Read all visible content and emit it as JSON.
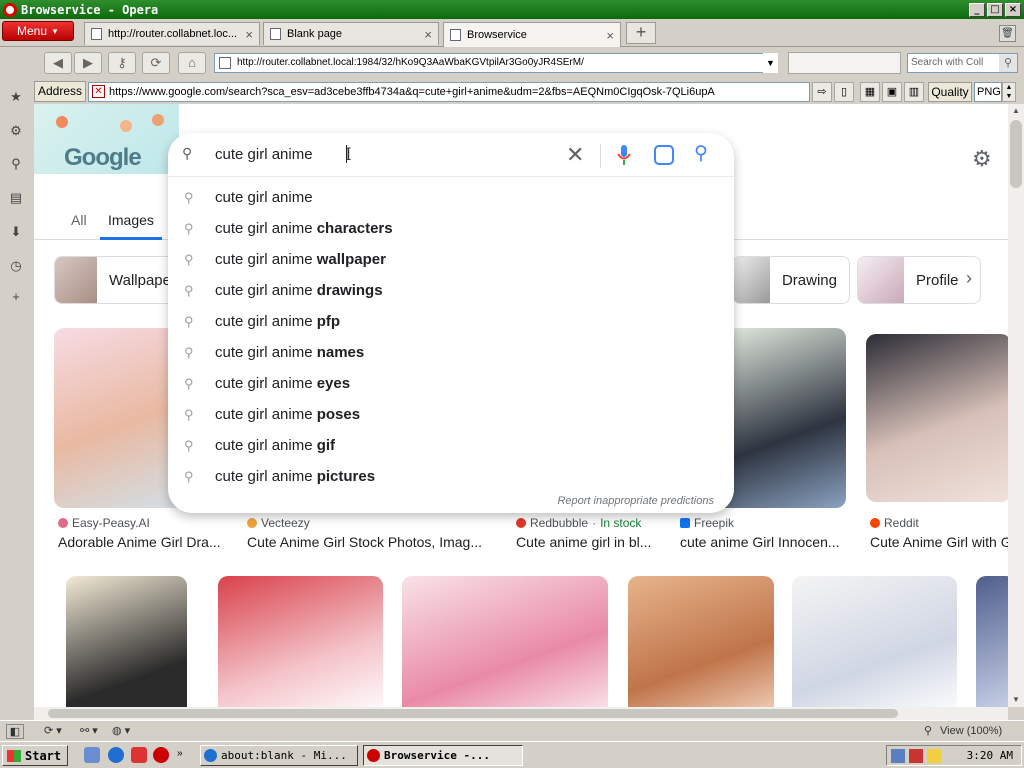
{
  "window": {
    "title": "Browservice - Opera",
    "controls": [
      "_",
      "□",
      "×"
    ]
  },
  "tabbar": {
    "menu_label": "Menu",
    "tabs": [
      {
        "label": "http://router.collabnet.loc...",
        "close": "×"
      },
      {
        "label": "Blank page",
        "close": "×"
      },
      {
        "label": "Browservice",
        "close": "×"
      }
    ],
    "new_tab": "+"
  },
  "navbar": {
    "url": "http://router.collabnet.local:1984/32/hKo9Q3AaWbaKGVtpilAr3Go0yJR4SErM/",
    "search_placeholder": "Search with Coll"
  },
  "addressbar": {
    "label": "Address",
    "url": "https://www.google.com/search?sca_esv=ad3cebe3ffb4734a&q=cute+girl+anime&udm=2&fbs=AEQNm0CIgqOsk-7QLi6upA",
    "quality_label": "Quality",
    "format": "PNG"
  },
  "google": {
    "logo_text": "Google",
    "tabs": [
      {
        "label": "All"
      },
      {
        "label": "Images"
      }
    ],
    "chips": [
      {
        "label": "Wallpape"
      },
      {
        "label": "Drawing"
      },
      {
        "label": "Profile"
      }
    ],
    "results_row1": [
      {
        "source": "Easy-Peasy.AI",
        "title": "Adorable Anime Girl Dra...",
        "color": "#e46a8a"
      },
      {
        "source": "Vecteezy",
        "title": "Cute Anime Girl Stock Photos, Imag...",
        "color": "#f2a33a"
      },
      {
        "source": "Redbubble",
        "stock": "In stock",
        "title": "Cute anime girl in bl...",
        "color": "#e0392b"
      },
      {
        "source": "Freepik",
        "title": "cute anime Girl Innocen...",
        "color": "#1273eb"
      },
      {
        "source": "Reddit",
        "title": "Cute Anime Girl with G",
        "color": "#ff4500"
      }
    ]
  },
  "search": {
    "query": "cute girl anime",
    "suggestion_prefix": "cute girl anime",
    "suggestions": [
      {
        "bold": ""
      },
      {
        "bold": "characters"
      },
      {
        "bold": "wallpaper"
      },
      {
        "bold": "drawings"
      },
      {
        "bold": "pfp"
      },
      {
        "bold": "names"
      },
      {
        "bold": "eyes"
      },
      {
        "bold": "poses"
      },
      {
        "bold": "gif"
      },
      {
        "bold": "pictures"
      }
    ],
    "report_text": "Report inappropriate predictions"
  },
  "statusbar": {
    "zoom": "View (100%)"
  },
  "taskbar": {
    "start_label": "Start",
    "tasks": [
      {
        "label": "about:blank - Mi..."
      },
      {
        "label": "Browservice -..."
      }
    ],
    "clock": "3:20 AM"
  }
}
